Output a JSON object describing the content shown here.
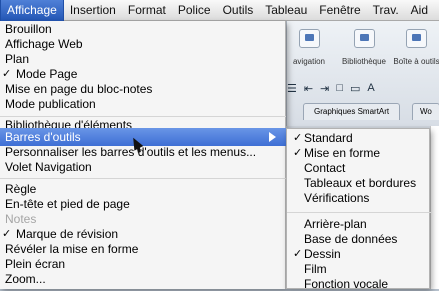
{
  "menubar": {
    "items": [
      "Affichage",
      "Insertion",
      "Format",
      "Police",
      "Outils",
      "Tableau",
      "Fenêtre",
      "Trav.",
      "Aid"
    ]
  },
  "ribbon": {
    "buttons": [
      "avigation",
      "Bibliothèque",
      "Boîte à outils"
    ],
    "tabs": [
      "Graphiques SmartArt",
      "Wo"
    ]
  },
  "view_menu": {
    "items": [
      {
        "label": "Brouillon"
      },
      {
        "label": "Affichage Web"
      },
      {
        "label": "Plan"
      },
      {
        "label": "Mode Page",
        "checked": true
      },
      {
        "label": "Mise en page du bloc-notes"
      },
      {
        "label": "Mode publication"
      },
      {
        "label": "Bibliothèque d'éléments"
      },
      {
        "label": "Barres d'outils"
      },
      {
        "label": "Personnaliser les barres d'outils et les menus..."
      },
      {
        "label": "Volet Navigation"
      },
      {
        "label": "Règle"
      },
      {
        "label": "En-tête et pied de page"
      },
      {
        "label": "Notes",
        "disabled": true
      },
      {
        "label": "Marque de révision",
        "checked": true
      },
      {
        "label": "Révéler la mise en forme"
      },
      {
        "label": "Plein écran"
      },
      {
        "label": "Zoom..."
      }
    ],
    "check_mark": "✓"
  },
  "toolbars_submenu": {
    "items": [
      {
        "label": "Standard",
        "checked": true
      },
      {
        "label": "Mise en forme",
        "checked": true
      },
      {
        "label": "Contact"
      },
      {
        "label": "Tableaux et bordures"
      },
      {
        "label": "Vérifications"
      },
      {
        "label": "Arrière-plan"
      },
      {
        "label": "Base de données"
      },
      {
        "label": "Dessin",
        "checked": true
      },
      {
        "label": "Film"
      },
      {
        "label": "Fonction vocale"
      }
    ]
  }
}
